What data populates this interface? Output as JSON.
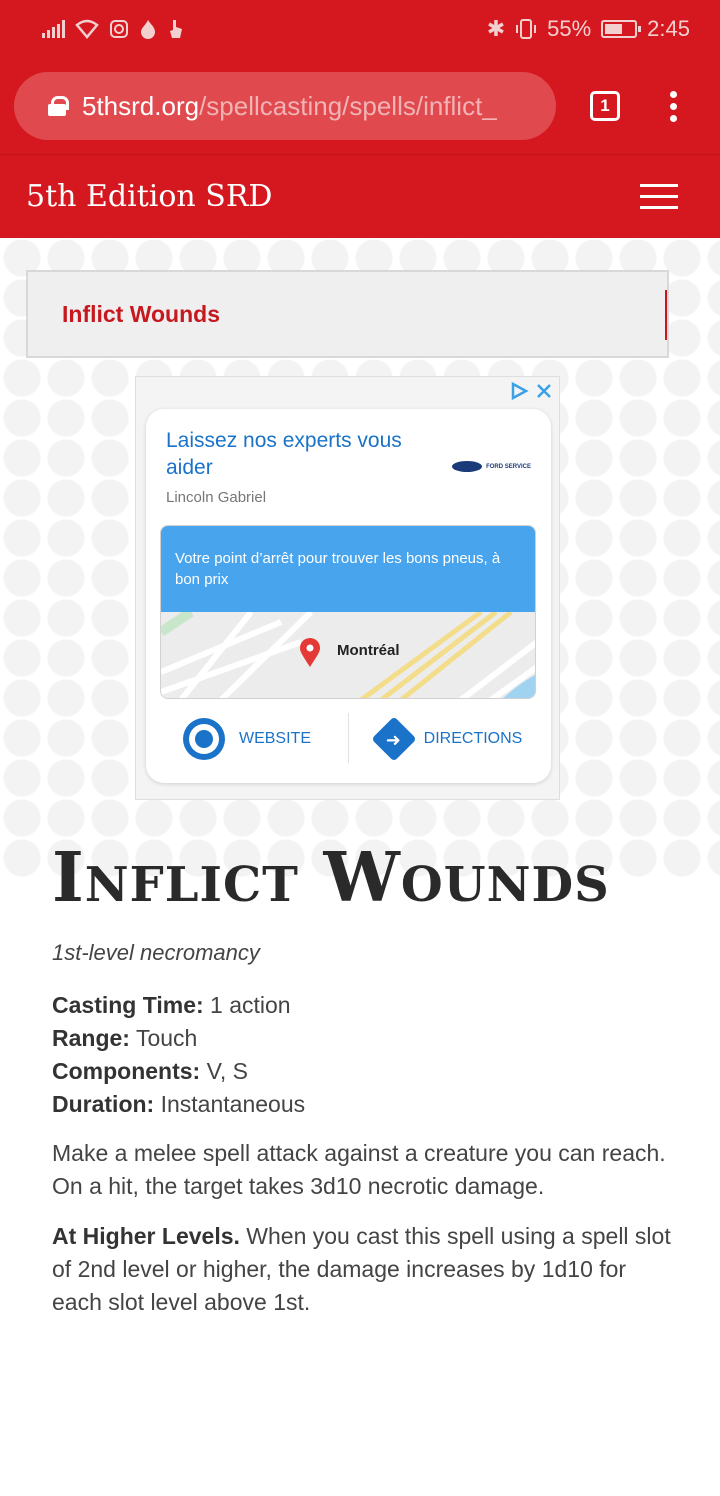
{
  "status_bar": {
    "battery": "55%",
    "time": "2:45"
  },
  "browser": {
    "url_domain": "5thsrd.org",
    "url_path": "/spellcasting/spells/inflict_",
    "tab_count": "1"
  },
  "site": {
    "title": "5th Edition SRD"
  },
  "breadcrumb": {
    "label": "Inflict Wounds"
  },
  "ad": {
    "headline": "Laissez nos experts vous aider",
    "brand_logo_text": "FORD SERVICE",
    "advertiser": "Lincoln Gabriel",
    "map_caption": "Votre point d’arrêt pour trouver les bons pneus, à bon prix",
    "map_city": "Montréal",
    "website_label": "WEBSITE",
    "directions_label": "DIRECTIONS"
  },
  "spell": {
    "title": "Inflict Wounds",
    "level_school": "1st-level necromancy",
    "casting_time_label": "Casting Time:",
    "casting_time": "1 action",
    "range_label": "Range:",
    "range": "Touch",
    "components_label": "Components:",
    "components": "V, S",
    "duration_label": "Duration:",
    "duration": "Instantaneous",
    "description": "Make a melee spell attack against a creature you can reach. On a hit, the target takes 3d10 necrotic damage.",
    "higher_levels_label": "At Higher Levels.",
    "higher_levels": "When you cast this spell using a spell slot of 2nd level or higher, the damage increases by 1d10 for each slot level above 1st."
  },
  "colors": {
    "brand_red": "#d5181f",
    "link_blue": "#1a73c8"
  }
}
